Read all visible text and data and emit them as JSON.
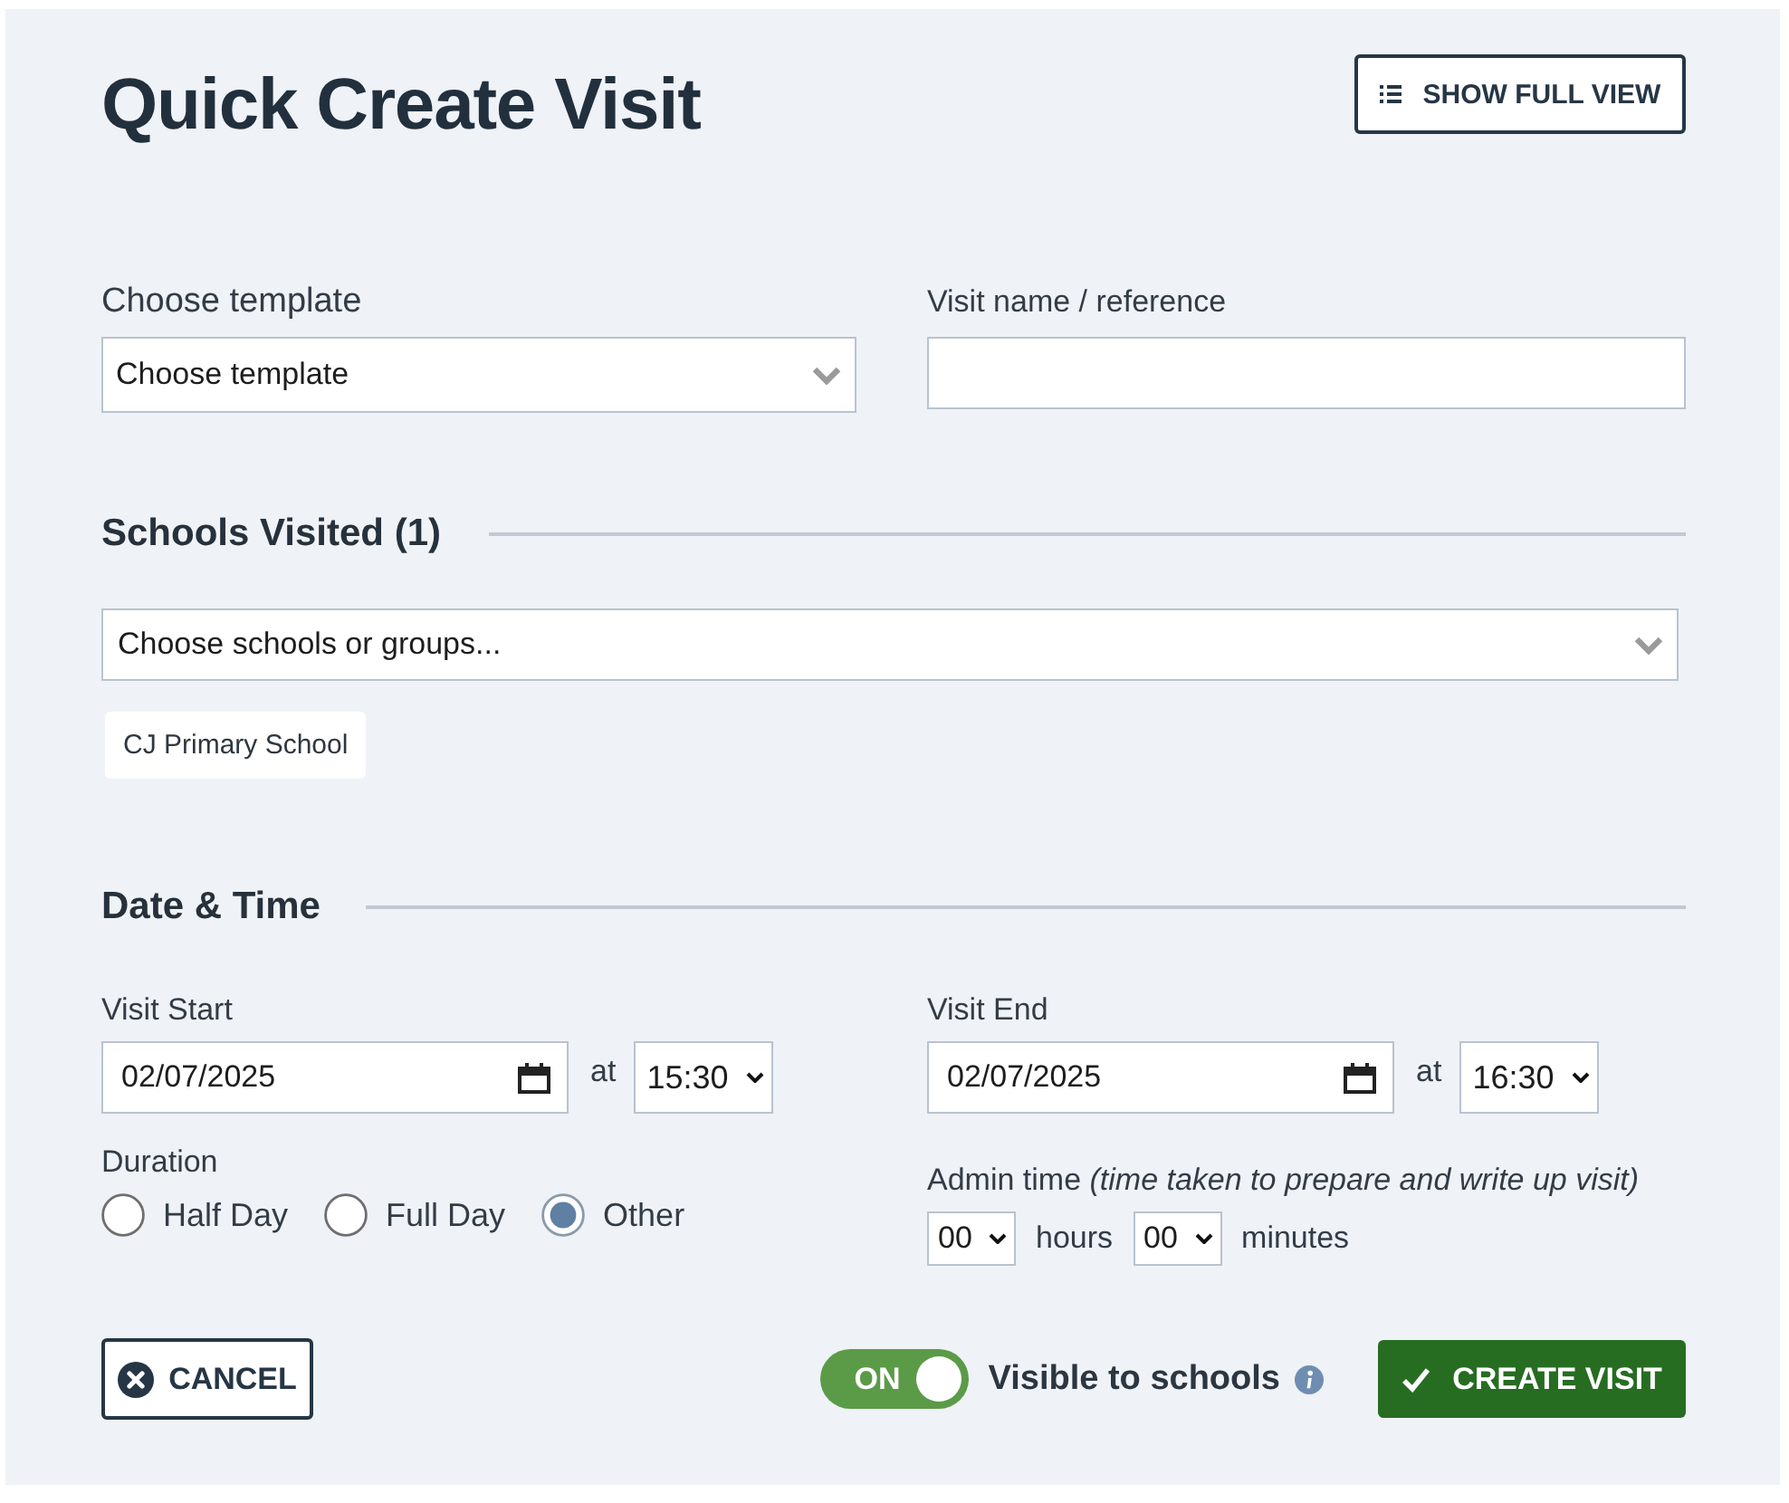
{
  "title": "Quick Create Visit",
  "header_button": {
    "label": "SHOW FULL VIEW"
  },
  "template": {
    "label": "Choose template",
    "value": "Choose template"
  },
  "visit_name": {
    "label": "Visit name / reference"
  },
  "schools": {
    "heading": "Schools Visited (1)",
    "picker": {
      "placeholder": "Choose schools or groups..."
    },
    "tags": [
      {
        "label": "CJ Primary School"
      }
    ]
  },
  "date_time": {
    "heading": "Date & Time",
    "start": {
      "label": "Visit Start",
      "date": "02/07/2025",
      "at": "at",
      "time": "15:30"
    },
    "end": {
      "label": "Visit End",
      "date": "02/07/2025",
      "at": "at",
      "time": "16:30"
    },
    "duration": {
      "label": "Duration",
      "options": [
        {
          "label": "Half Day",
          "selected": false
        },
        {
          "label": "Full Day",
          "selected": false
        },
        {
          "label": "Other",
          "selected": true
        }
      ]
    },
    "admin_time": {
      "label": "Admin time *(time taken to prepare and write up visit)*",
      "hours": "00",
      "hours_unit": "hours",
      "minutes": "00",
      "minutes_unit": "minutes"
    }
  },
  "footer": {
    "cancel": "CANCEL",
    "toggle": {
      "on": true,
      "label": "ON"
    },
    "visible_label": "Visible to schools",
    "create": "CREATE VISIT"
  }
}
